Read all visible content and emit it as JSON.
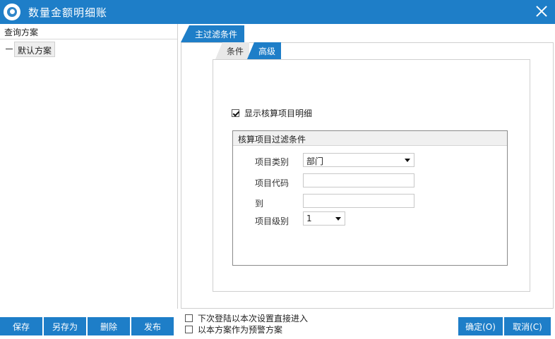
{
  "window": {
    "title": "数量金额明细账",
    "icon": "app-logo-icon",
    "close_icon": "close-icon"
  },
  "left_panel": {
    "header": "查询方案",
    "tree_items": [
      {
        "label": "默认方案"
      }
    ]
  },
  "main_tabs": [
    {
      "label": "主过滤条件",
      "active": true
    }
  ],
  "sub_tabs": [
    {
      "label": "条件",
      "active": false
    },
    {
      "label": "高级",
      "active": true
    }
  ],
  "advanced": {
    "show_detail": {
      "label": "显示核算项目明细",
      "checked": true
    },
    "group": {
      "title": "核算项目过滤条件",
      "item_type": {
        "label": "项目类别",
        "value": "部门"
      },
      "item_code": {
        "label": "项目代码",
        "value": ""
      },
      "item_to": {
        "label": "到",
        "value": ""
      },
      "item_level": {
        "label": "项目级别",
        "value": "1"
      }
    }
  },
  "bottom": {
    "left_buttons": [
      "保存",
      "另存为",
      "删除",
      "发布"
    ],
    "options": [
      {
        "label": "下次登陆以本次设置直接进入",
        "checked": false
      },
      {
        "label": "以本方案作为预警方案",
        "checked": false
      }
    ],
    "ok": "确定(O)",
    "cancel": "取消(C)"
  },
  "colors": {
    "accent": "#1e7ec8",
    "border": "#cfcfcf"
  }
}
